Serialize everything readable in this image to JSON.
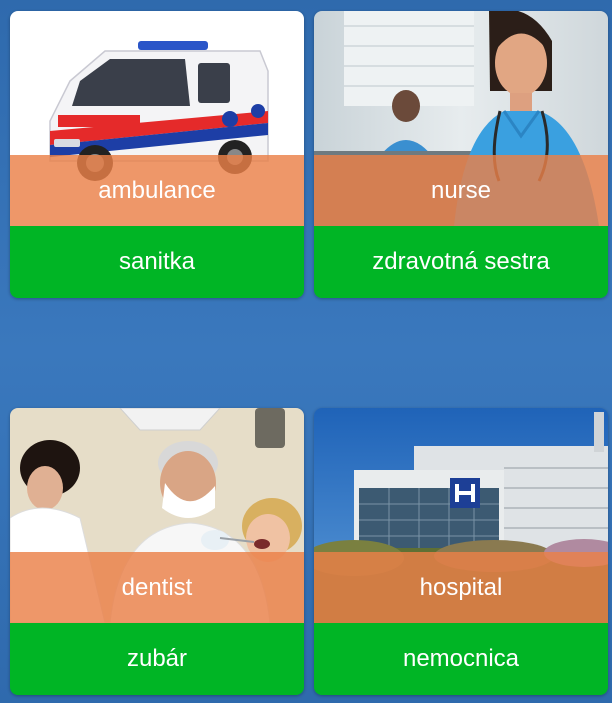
{
  "cards": [
    {
      "english": "ambulance",
      "translation": "sanitka",
      "image": "ambulance-photo"
    },
    {
      "english": "nurse",
      "translation": "zdravotná sestra",
      "image": "nurse-photo"
    },
    {
      "english": "dentist",
      "translation": "zubár",
      "image": "dentist-photo"
    },
    {
      "english": "hospital",
      "translation": "nemocnica",
      "image": "hospital-photo"
    }
  ],
  "colors": {
    "background": "#3270b4",
    "english_band": "#ea8048",
    "translation_band": "#00b525",
    "text": "#ffffff"
  }
}
